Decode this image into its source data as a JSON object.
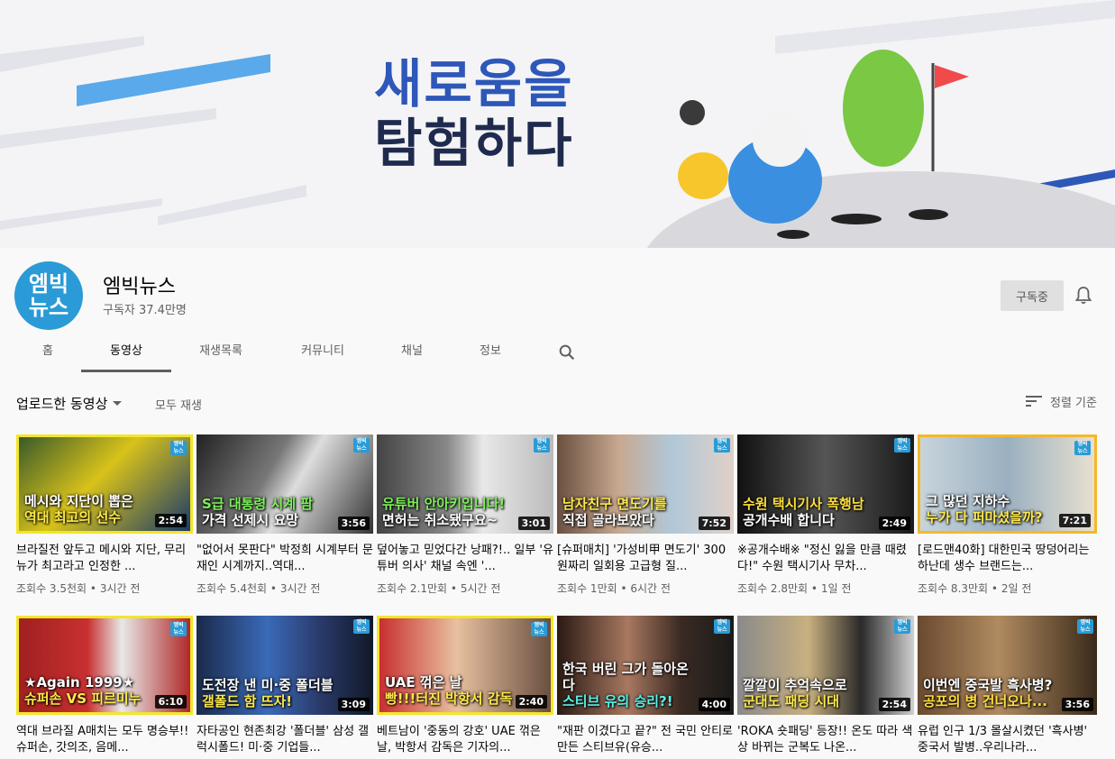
{
  "banner": {
    "line1": "새로움을",
    "line2": "탐험하다"
  },
  "channel": {
    "avatar_line1": "엠빅",
    "avatar_line2": "뉴스",
    "name": "엠빅뉴스",
    "subscribers": "구독자 37.4만명",
    "subscribe_label": "구독중"
  },
  "tabs": [
    {
      "label": "홈"
    },
    {
      "label": "동영상"
    },
    {
      "label": "재생목록"
    },
    {
      "label": "커뮤니티"
    },
    {
      "label": "채널"
    },
    {
      "label": "정보"
    }
  ],
  "toolbar": {
    "uploads_label": "업로드한 동영상",
    "play_all": "모두 재생",
    "sort_label": "정렬 기준"
  },
  "badge": {
    "line1": "엠빅",
    "line2": "뉴스"
  },
  "videos": [
    {
      "ov1": "메시와 지단이 뽑은",
      "ov2": "역대 최고의 선수",
      "duration": "2:54",
      "title": "브라질전 앞두고 메시와 지단, 무리뉴가 최고라고 인정한 ...",
      "views": "조회수 3.5천회",
      "age": "3시간 전"
    },
    {
      "ov1": "S급 대통령 시계 팜",
      "ov2": "가격 선제시 요망",
      "duration": "3:56",
      "title": "\"없어서 못판다\" 박정희 시계부터 문재인 시계까지..역대...",
      "views": "조회수 5.4천회",
      "age": "3시간 전"
    },
    {
      "ov1": "유튜버 안아키입니다!",
      "ov2": "면허는 취소됐구요~",
      "duration": "3:01",
      "title": "덮어놓고 믿었다간 낭패?!.. 일부 '유튜버 의사' 채널 속엔 '...",
      "views": "조회수 2.1만회",
      "age": "5시간 전"
    },
    {
      "ov1": "남자친구 면도기를",
      "ov2": "직접 골라보았다",
      "duration": "7:52",
      "title": "[슈퍼매치] '가성비甲 면도기' 300원짜리 일회용 고급형 질...",
      "views": "조회수 1만회",
      "age": "6시간 전"
    },
    {
      "ov1": "수원 택시기사 폭행남",
      "ov2": "공개수배 합니다",
      "duration": "2:49",
      "title": "※공개수배※ \"정신 잃을 만큼 때렸다!\" 수원 택시기사 무차...",
      "views": "조회수 2.8만회",
      "age": "1일 전"
    },
    {
      "ov1": "그 많던 지하수",
      "ov2": "누가 다 퍼마셨을까?",
      "duration": "7:21",
      "title": "[로드맨40화] 대한민국 땅덩어리는 하난데 생수 브랜드는...",
      "views": "조회수 8.3만회",
      "age": "2일 전"
    },
    {
      "ov1": "★Again 1999★",
      "ov2": "슈퍼손 VS 피르미누",
      "duration": "6:10",
      "title": "역대 브라질 A매치는 모두 명승부!! 슈퍼손, 갓의조, 음메...",
      "views": "",
      "age": ""
    },
    {
      "ov1": "도전장 낸 미·중 폴더블",
      "ov2": "갤폴드 함 뜨자!",
      "duration": "3:09",
      "title": "자타공인 현존최강 '폴더블' 삼성 갤럭시폴드! 미·중 기업들...",
      "views": "",
      "age": ""
    },
    {
      "ov1": "UAE 꺾은 날",
      "ov2": "빵!!!터진 박항서 감독",
      "duration": "2:40",
      "title": "베트남이 '중동의 강호' UAE 꺾은 날, 박항서 감독은 기자의...",
      "views": "",
      "age": ""
    },
    {
      "ov1": "한국 버린 그가 돌아온다",
      "ov2": "스티브 유의 승리?!",
      "duration": "4:00",
      "title": "\"재판 이겼다고 끝?\" 전 국민 안티로 만든 스티브유(유승...",
      "views": "",
      "age": ""
    },
    {
      "ov1": "깔깔이 추억속으로",
      "ov2": "군대도 패딩 시대",
      "duration": "2:54",
      "title": "'ROKA 숏패딩' 등장!! 온도 따라 색상 바뀌는 군복도 나온...",
      "views": "",
      "age": ""
    },
    {
      "ov1": "이번엔 중국발 흑사병?",
      "ov2": "공포의 병 건너오나...",
      "duration": "3:56",
      "title": "유럽 인구 1/3 몰살시켰던 '흑사병' 중국서 발병..우리나라...",
      "views": "",
      "age": ""
    }
  ]
}
